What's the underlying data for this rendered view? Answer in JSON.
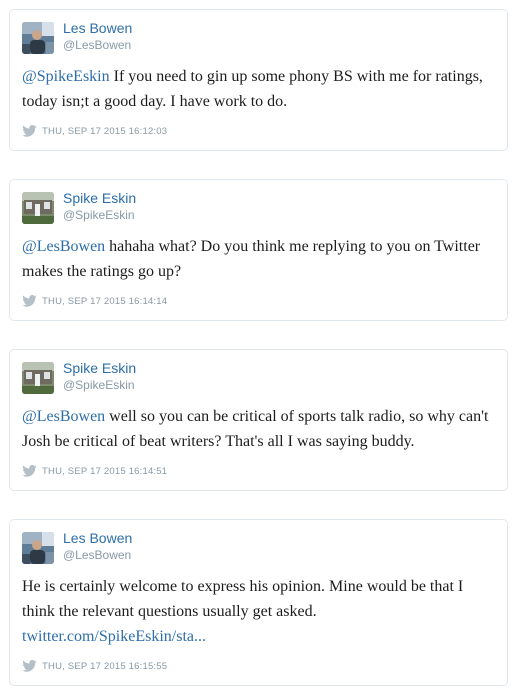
{
  "colors": {
    "link": "#2d6ea8",
    "muted": "#8899a6",
    "border": "#e1e8ed"
  },
  "tweets": [
    {
      "avatar_icon": "les-bowen-avatar",
      "name": "Les Bowen",
      "handle": "@LesBowen",
      "mention": "@SpikeEskin",
      "text": " If you need to gin up some phony BS with me for ratings, today isn;t a good day. I have work to do.",
      "link": "",
      "icon": "twitter-bird-icon",
      "timestamp": "THU, SEP 17 2015 16:12:03"
    },
    {
      "avatar_icon": "spike-eskin-avatar",
      "name": "Spike Eskin",
      "handle": "@SpikeEskin",
      "mention": "@LesBowen",
      "text": " hahaha what? Do you think me replying to you on Twitter makes the ratings go up?",
      "link": "",
      "icon": "twitter-bird-icon",
      "timestamp": "THU, SEP 17 2015 16:14:14"
    },
    {
      "avatar_icon": "spike-eskin-avatar",
      "name": "Spike Eskin",
      "handle": "@SpikeEskin",
      "mention": "@LesBowen",
      "text": " well so you can be critical of sports talk radio, so why can't Josh be critical of beat writers? That's all I was saying buddy.",
      "link": "",
      "icon": "twitter-bird-icon",
      "timestamp": "THU, SEP 17 2015 16:14:51"
    },
    {
      "avatar_icon": "les-bowen-avatar",
      "name": "Les Bowen",
      "handle": "@LesBowen",
      "mention": "",
      "text": "He is certainly welcome to express his opinion. Mine would be that I think the relevant questions usually get asked. ",
      "link": "twitter.com/SpikeEskin/sta...",
      "icon": "twitter-bird-icon",
      "timestamp": "THU, SEP 17 2015 16:15:55"
    }
  ]
}
